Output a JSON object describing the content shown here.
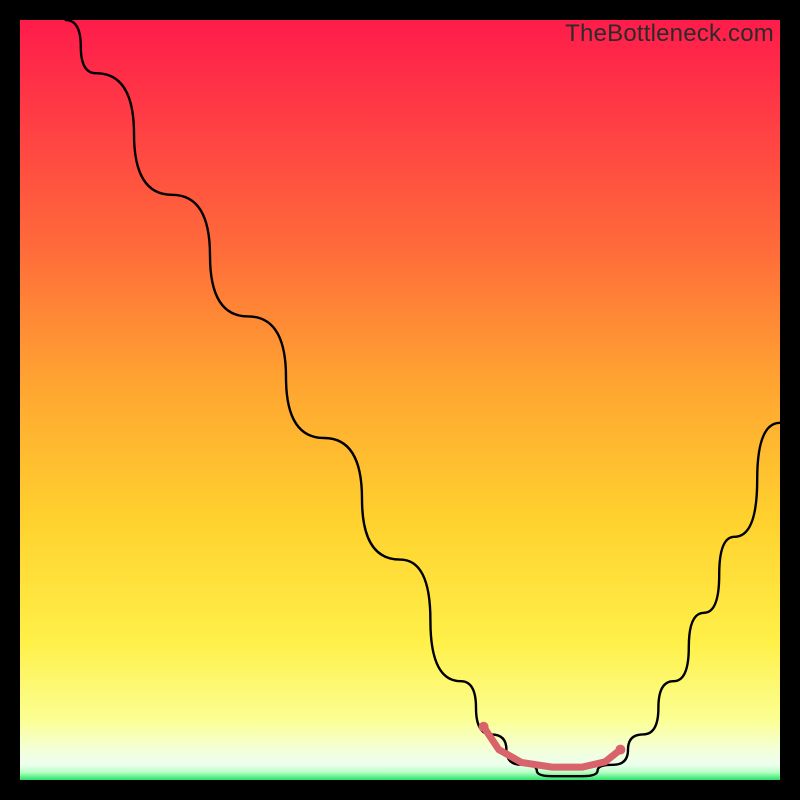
{
  "watermark": "TheBottleneck.com",
  "chart_data": {
    "type": "line",
    "title": "",
    "xlabel": "",
    "ylabel": "",
    "xlim": [
      0,
      100
    ],
    "ylim": [
      0,
      100
    ],
    "grid": false,
    "legend": false,
    "series": [
      {
        "name": "curve",
        "color": "#000000",
        "x": [
          6,
          10,
          20,
          30,
          40,
          50,
          58,
          62,
          66,
          70,
          74,
          78,
          82,
          86,
          90,
          94,
          100
        ],
        "y": [
          100,
          93,
          77,
          61,
          45,
          29,
          13,
          6,
          2,
          0.5,
          0.5,
          2,
          6,
          13,
          22,
          32,
          47
        ]
      },
      {
        "name": "highlight-segment",
        "color": "#d9636b",
        "x": [
          61,
          63,
          66,
          70,
          74,
          77,
          79
        ],
        "y": [
          7,
          4,
          2.3,
          1.7,
          1.7,
          2.4,
          4
        ]
      }
    ]
  },
  "colors": {
    "background": "#000000",
    "curve": "#000000",
    "highlight": "#d9636b"
  }
}
